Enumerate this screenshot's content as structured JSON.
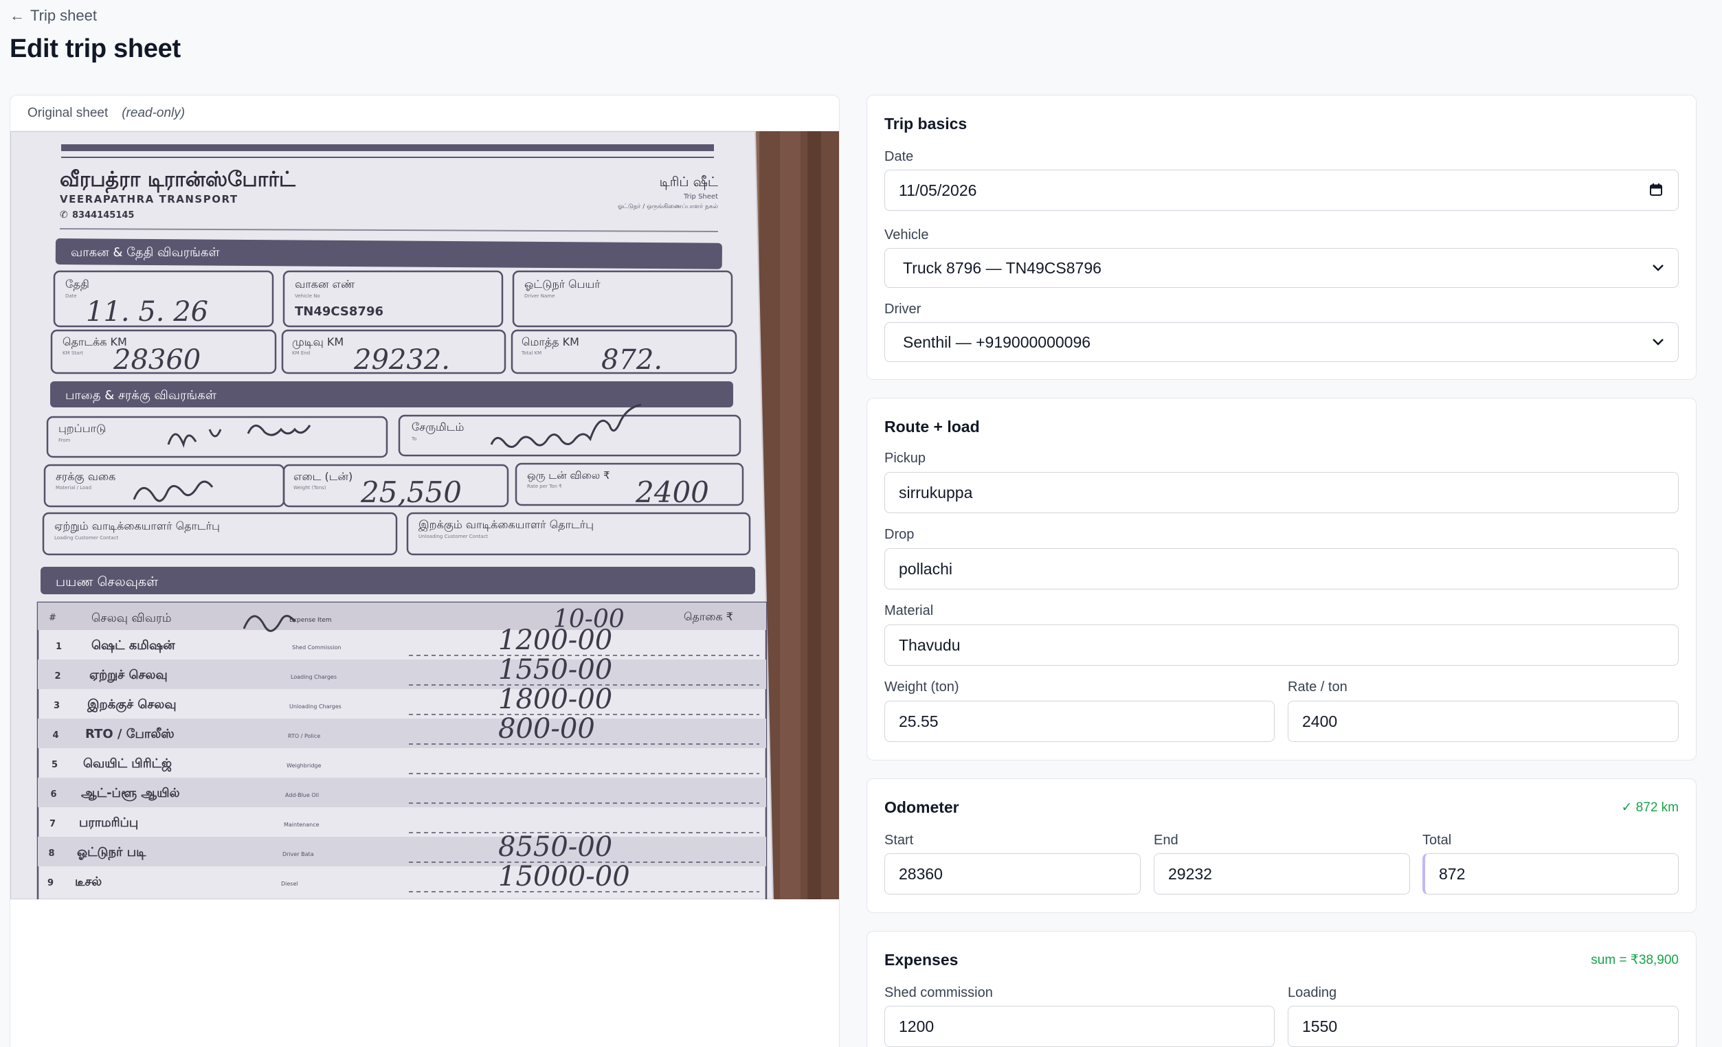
{
  "nav": {
    "back_label": "Trip sheet",
    "back_icon": "arrow-left-icon"
  },
  "page": {
    "title": "Edit trip sheet"
  },
  "original": {
    "label": "Original sheet",
    "note": "(read-only)",
    "sheet": {
      "company_tamil": "வீரபத்ரா டிரான்ஸ்போர்ட்",
      "company_english": "VEERAPATHRA TRANSPORT",
      "phone": "8344145145",
      "doc_title_tamil": "டிரிப் ஷீட்",
      "doc_title_english": "Trip Sheet",
      "doc_subtitle": "ஓட்டுநர் / ஒருங்கிணைப்பாளர் நகல்",
      "section1": "வாகன & தேதி விவரங்கள்",
      "date_label": "தேதி",
      "date_sub": "Date",
      "date_value": "11. 5. 26",
      "vehicle_label": "வாகன எண்",
      "vehicle_sub": "Vehicle No",
      "vehicle_value": "TN49CS8796",
      "driver_label": "ஓட்டுநர் பெயர்",
      "driver_sub": "Driver Name",
      "km_start_label": "தொடக்க KM",
      "km_start_sub": "KM Start",
      "km_start_value": "28360",
      "km_end_label": "முடிவு KM",
      "km_end_sub": "KM End",
      "km_end_value": "29232.",
      "km_total_label": "மொத்த KM",
      "km_total_sub": "Total KM",
      "km_total_value": "872.",
      "section2": "பாதை & சரக்கு விவரங்கள்",
      "from_label": "புறப்பாடு",
      "from_sub": "From",
      "to_label": "சேருமிடம்",
      "to_sub": "To",
      "material_label": "சரக்கு வகை",
      "material_sub": "Material / Load",
      "weight_label": "எடை (டன்)",
      "weight_sub": "Weight (Tons)",
      "weight_value": "25,550",
      "rate_label": "ஒரு டன் விலை ₹",
      "rate_sub": "Rate per Ton ₹",
      "rate_value": "2400",
      "loading_contact_label": "ஏற்றும் வாடிக்கையாளர் தொடர்பு",
      "loading_contact_sub": "Loading Customer Contact",
      "unloading_contact_label": "இறக்கும் வாடிக்கையாளர் தொடர்பு",
      "unloading_contact_sub": "Unloading Customer Contact",
      "section3": "பயண செலவுகள்",
      "col_no": "#",
      "col_desc": "செலவு விவரம்",
      "col_expense": "Expense Item",
      "col_amount": "தொகை ₹",
      "header_amount": "10-00",
      "expenses": [
        {
          "no": "1",
          "ta": "ஷெட் கமிஷன்",
          "en": "Shed Commission",
          "amount": "1200-00"
        },
        {
          "no": "2",
          "ta": "ஏற்றுச் செலவு",
          "en": "Loading Charges",
          "amount": "1550-00"
        },
        {
          "no": "3",
          "ta": "இறக்குச் செலவு",
          "en": "Unloading Charges",
          "amount": "1800-00"
        },
        {
          "no": "4",
          "ta": "RTO / போலீஸ்",
          "en": "RTO / Police",
          "amount": "800-00"
        },
        {
          "no": "5",
          "ta": "வெயிட் பிரிட்ஜ்",
          "en": "Weighbridge",
          "amount": ""
        },
        {
          "no": "6",
          "ta": "ஆட்-ப்ளூ ஆயில்",
          "en": "Add-Blue Oil",
          "amount": ""
        },
        {
          "no": "7",
          "ta": "பராமரிப்பு",
          "en": "Maintenance",
          "amount": ""
        },
        {
          "no": "8",
          "ta": "ஓட்டுநர் படி",
          "en": "Driver Bata",
          "amount": "8550-00"
        },
        {
          "no": "9",
          "ta": "டீசல்",
          "en": "Diesel",
          "amount": "15000-00"
        }
      ]
    }
  },
  "trip_basics": {
    "title": "Trip basics",
    "date_label": "Date",
    "date_value": "11/05/2026",
    "vehicle_label": "Vehicle",
    "vehicle_value": "Truck 8796 — TN49CS8796",
    "driver_label": "Driver",
    "driver_value": "Senthil — +919000000096"
  },
  "route_load": {
    "title": "Route + load",
    "pickup_label": "Pickup",
    "pickup_value": "sirrukuppa",
    "drop_label": "Drop",
    "drop_value": "pollachi",
    "material_label": "Material",
    "material_value": "Thavudu",
    "weight_label": "Weight (ton)",
    "weight_value": "25.55",
    "rate_label": "Rate / ton",
    "rate_value": "2400"
  },
  "odometer": {
    "title": "Odometer",
    "status": "✓ 872 km",
    "start_label": "Start",
    "start_value": "28360",
    "end_label": "End",
    "end_value": "29232",
    "total_label": "Total",
    "total_value": "872"
  },
  "expenses": {
    "title": "Expenses",
    "sum": "sum = ₹38,900",
    "shed_label": "Shed commission",
    "shed_value": "1200",
    "loading_label": "Loading",
    "loading_value": "1550"
  },
  "colors": {
    "accent_green": "#16a34a",
    "band_purple": "#5b5670",
    "total_indicator": "#c4b5fd"
  }
}
